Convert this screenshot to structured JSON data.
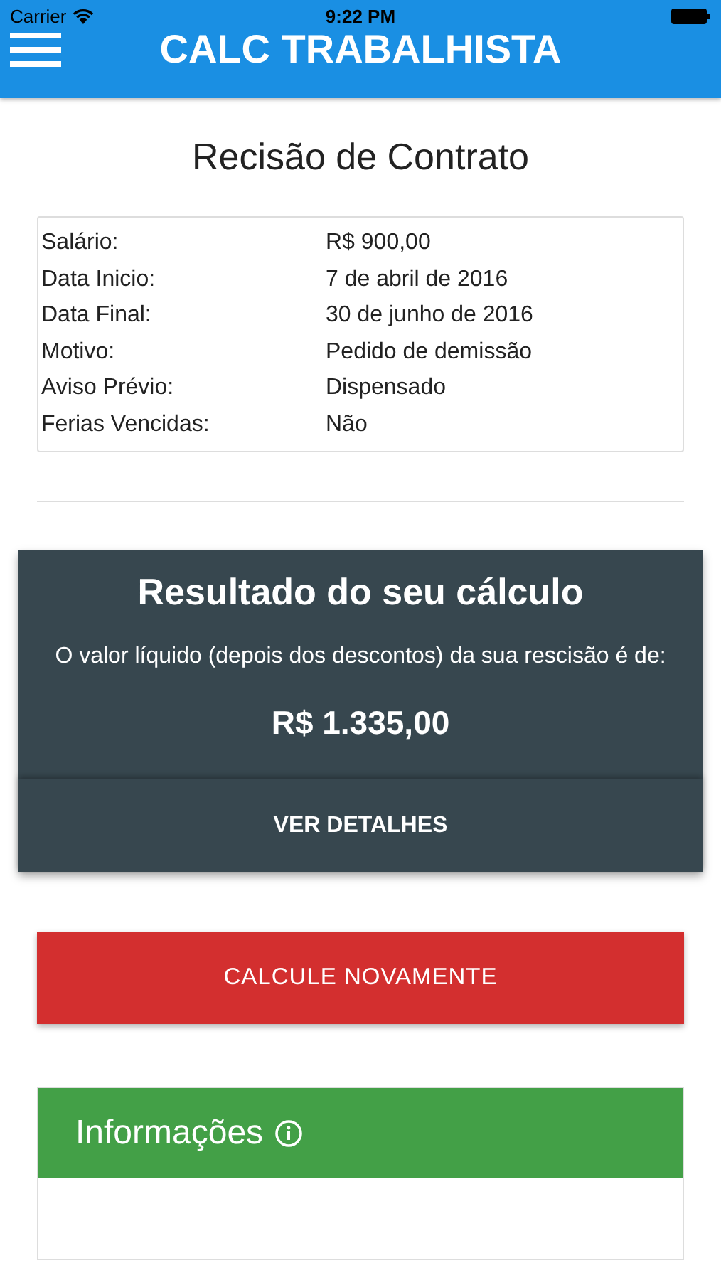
{
  "status_bar": {
    "carrier": "Carrier",
    "time": "9:22 PM"
  },
  "header": {
    "title": "CALC TRABALHISTA"
  },
  "page_title": "Recisão de Contrato",
  "summary": [
    {
      "label": "Salário:",
      "value": "R$ 900,00"
    },
    {
      "label": "Data Inicio:",
      "value": "7 de abril de 2016"
    },
    {
      "label": "Data Final:",
      "value": "30 de junho de 2016"
    },
    {
      "label": "Motivo:",
      "value": "Pedido de demissão"
    },
    {
      "label": "Aviso Prévio:",
      "value": "Dispensado"
    },
    {
      "label": "Ferias Vencidas:",
      "value": "Não"
    }
  ],
  "result": {
    "title": "Resultado do seu cálculo",
    "description": "O valor líquido (depois dos descontos) da sua rescisão é de:",
    "amount": "R$ 1.335,00",
    "button": "VER DETALHES"
  },
  "recalculate_button": "CALCULE NOVAMENTE",
  "info": {
    "title": "Informações"
  }
}
